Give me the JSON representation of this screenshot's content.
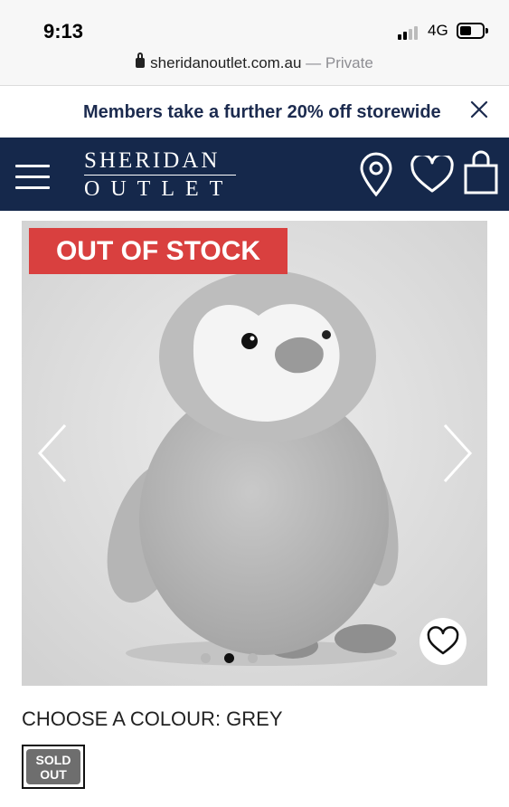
{
  "status_bar": {
    "time": "9:13",
    "network": "4G",
    "url": "sheridanoutlet.com.au",
    "separator": " — ",
    "private_label": "Private"
  },
  "promo": {
    "text": "Members take a further 20% off storewide",
    "close_icon": "close-icon"
  },
  "header": {
    "logo_top": "SHERIDAN",
    "logo_bottom": "OUTLET",
    "icons": [
      "menu-icon",
      "location-pin-icon",
      "heart-icon",
      "shopping-bag-icon"
    ],
    "background": "#15284b"
  },
  "product": {
    "badge": "OUT OF STOCK",
    "badge_color": "#d9403f",
    "carousel_index": 2,
    "carousel_total": 3
  },
  "colour": {
    "label": "CHOOSE A COLOUR: GREY",
    "swatch_line1": "SOLD",
    "swatch_line2": "OUT"
  }
}
